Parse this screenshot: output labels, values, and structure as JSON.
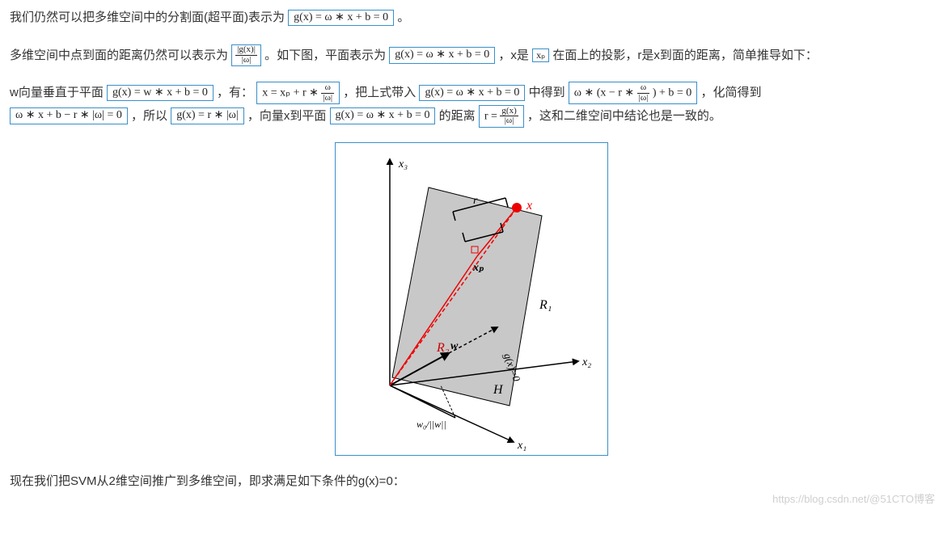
{
  "p1": {
    "t1": "我们仍然可以把多维空间中的分割面(超平面)表示为",
    "f1": "g(x) = ω ∗ x + b = 0",
    "t2": "。"
  },
  "p2": {
    "t1": "多维空间中点到面的距离仍然可以表示为",
    "f1_top": "|g(x)|",
    "f1_bot": "|ω|",
    "t2": "。如下图，平面表示为",
    "f2": "g(x) = ω ∗ x + b = 0",
    "t3": "，x是",
    "f3": "xₚ",
    "t4": "在面上的投影，r是x到面的距离，简单推导如下："
  },
  "p3": {
    "t1": "w向量垂直于平面",
    "f1": "g(x) = w ∗ x + b = 0",
    "t2": "，有：",
    "f2_left": "x = xₚ + r ∗",
    "f2_top": "ω",
    "f2_bot": "|ω|",
    "t3": "，把上式带入",
    "f3": "g(x) = ω ∗ x + b = 0",
    "t4": "中得到",
    "f4_left": "ω ∗ (x − r ∗",
    "f4_top": "ω",
    "f4_bot": "|ω|",
    "f4_right": ") + b = 0",
    "t5": "，化简得到",
    "f5": "ω ∗ x + b − r ∗ |ω| = 0",
    "t6": "，所以",
    "f6": "g(x) = r ∗ |ω|",
    "t7": "，向量x到平面",
    "f7": "g(x) = ω ∗ x + b = 0",
    "t8": "的距离",
    "f8_left": "r =",
    "f8_top": "g(x)",
    "f8_bot": "|ω|",
    "t9": "，这和二维空间中结论也是一致的。"
  },
  "p4": {
    "t1": "现在我们把SVM从2维空间推广到多维空间，即求满足如下条件的g(x)=0："
  },
  "fig": {
    "x3": "x₃",
    "x2": "x₂",
    "x1": "x₁",
    "r1": "R₁",
    "r2": "R₂",
    "x": "x",
    "xp": "xₚ",
    "r": "r",
    "w": "w",
    "H": "H",
    "gx": "g(x)=0",
    "w0w": "w₀/||w||"
  },
  "watermark": "https://blog.csdn.net/@51CTO博客"
}
